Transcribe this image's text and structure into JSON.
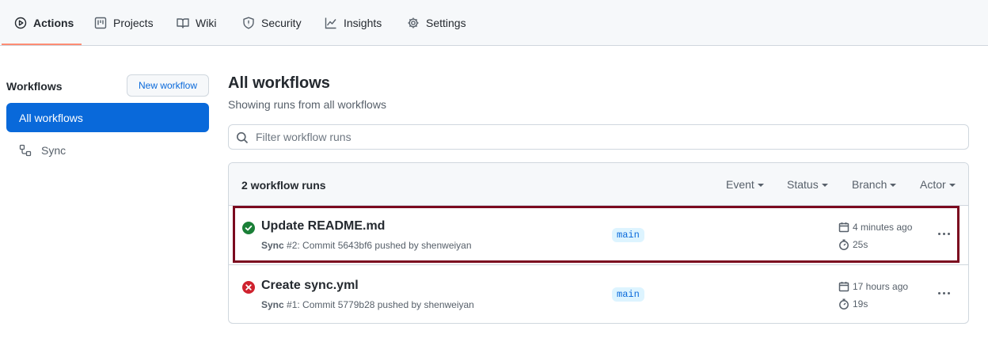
{
  "nav": {
    "tabs": [
      {
        "label": "Actions",
        "icon": "play-icon"
      },
      {
        "label": "Projects",
        "icon": "project-icon"
      },
      {
        "label": "Wiki",
        "icon": "book-icon"
      },
      {
        "label": "Security",
        "icon": "shield-icon"
      },
      {
        "label": "Insights",
        "icon": "graph-icon"
      },
      {
        "label": "Settings",
        "icon": "gear-icon"
      }
    ],
    "active_tab": "Actions"
  },
  "sidebar": {
    "title": "Workflows",
    "new_workflow_label": "New workflow",
    "items": [
      {
        "label": "All workflows",
        "active": true
      },
      {
        "label": "Sync",
        "icon": "workflow-icon",
        "active": false
      }
    ]
  },
  "main": {
    "title": "All workflows",
    "subtitle": "Showing runs from all workflows",
    "filter_placeholder": "Filter workflow runs",
    "run_count": "2 workflow runs",
    "filters": [
      "Event",
      "Status",
      "Branch",
      "Actor"
    ],
    "runs": [
      {
        "title": "Update README.md",
        "status": "success",
        "workflow": "Sync",
        "meta": " #2: Commit 5643bf6 pushed by shenweiyan",
        "branch": "main",
        "time": "4 minutes ago",
        "duration": "25s"
      },
      {
        "title": "Create sync.yml",
        "status": "failure",
        "workflow": "Sync",
        "meta": " #1: Commit 5779b28 pushed by shenweiyan",
        "branch": "main",
        "time": "17 hours ago",
        "duration": "19s"
      }
    ]
  },
  "colors": {
    "accent": "#0969da",
    "success": "#1a7f37",
    "failure": "#cf222e",
    "highlight": "#7b0a1f",
    "tab_underline": "#fd8c73"
  }
}
